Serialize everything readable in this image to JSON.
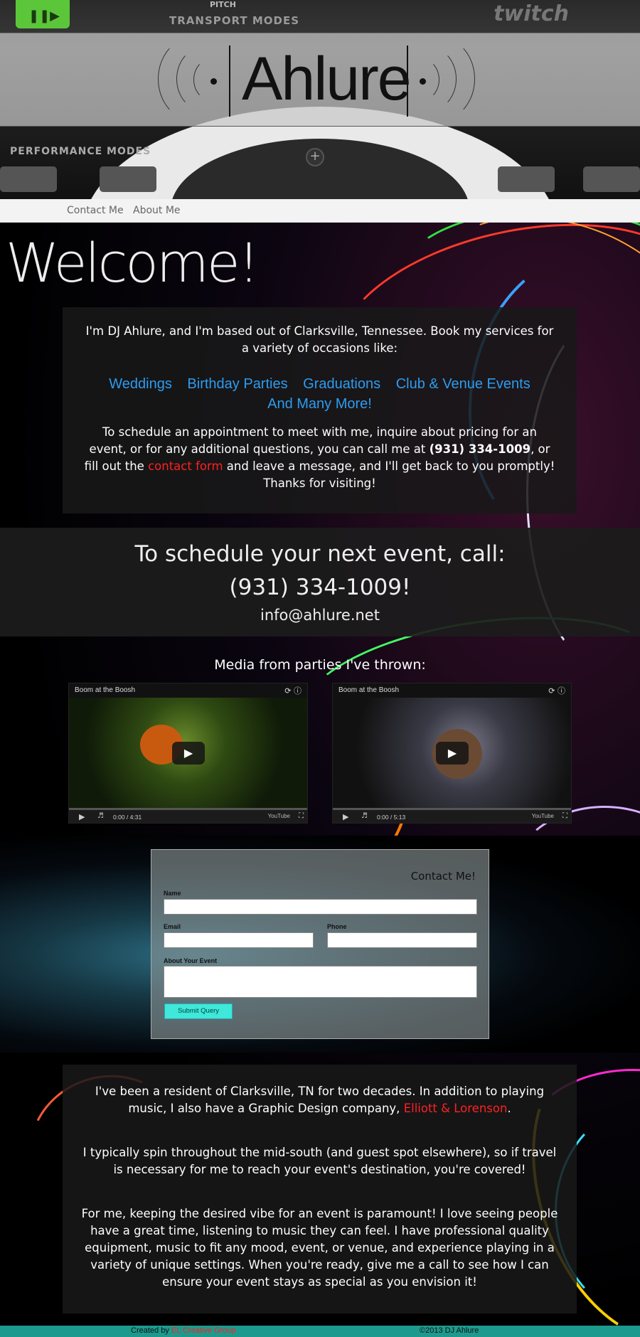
{
  "header": {
    "logo_text": "Ahlure",
    "deck_labels": [
      "PITCH",
      "TRANSPORT MODES",
      "PERFORMANCE MODES",
      "twitch"
    ]
  },
  "nav": {
    "items": [
      {
        "label": "Contact Me"
      },
      {
        "label": "About Me"
      }
    ]
  },
  "welcome": {
    "heading": "Welcome!",
    "intro": "I'm DJ Ahlure, and I'm based out of Clarksville, Tennessee. Book my services for a variety of occasions like:",
    "services": [
      "Weddings",
      "Birthday Parties",
      "Graduations",
      "Club & Venue Events",
      "And Many More!"
    ],
    "schedule_pre": "To schedule an appointment to meet with me, inquire about pricing for an event, or for any additional questions, you can call me at ",
    "phone_bold": "(931) 334-1009",
    "schedule_mid": ", or fill out the ",
    "contact_link": "contact form",
    "schedule_post": " and leave a message, and I'll get back to you promptly! Thanks for visiting!"
  },
  "call": {
    "line1": "To schedule your next event, call:",
    "line2": "(931) 334-1009!",
    "email": "info@ahlure.net"
  },
  "media": {
    "title": "Media from parties I've thrown:",
    "videos": [
      {
        "title": "Boom at the Boosh",
        "time": "0:00 / 4:31",
        "logo": "YouTube"
      },
      {
        "title": "Boom at the Boosh",
        "time": "0:00 / 5:13",
        "logo": "YouTube"
      }
    ]
  },
  "form": {
    "title": "Contact Me!",
    "name_label": "Name",
    "email_label": "Email",
    "phone_label": "Phone",
    "about_label": "About Your Event",
    "submit_label": "Submit Query"
  },
  "about": {
    "p1_pre": "I've been a resident of Clarksville, TN for two decades. In addition to playing music, I also have a Graphic Design company, ",
    "p1_link": "Elliott & Lorenson",
    "p1_post": ".",
    "p2": "I typically spin throughout the mid-south (and guest spot elsewhere), so if travel is necessary for me to reach your event's destination, you're covered!",
    "p3": "For me, keeping the desired vibe for an event is paramount! I love seeing people have a great time, listening to music they can feel. I have professional quality equipment, music to fit any mood, event, or venue, and experience playing in a variety of unique settings. When you're ready, give me a call to see how I can ensure your event stays as special as you envision it!"
  },
  "footer": {
    "created_by": "Created by ",
    "creator_link": "EL Creative Group",
    "copyright": "©2013 DJ Ahlure"
  },
  "colors": {
    "link_blue": "#2d9cf0",
    "link_red": "#ff2020",
    "footer_teal": "#1d9a8e",
    "submit_cyan": "#3fe8d8"
  }
}
